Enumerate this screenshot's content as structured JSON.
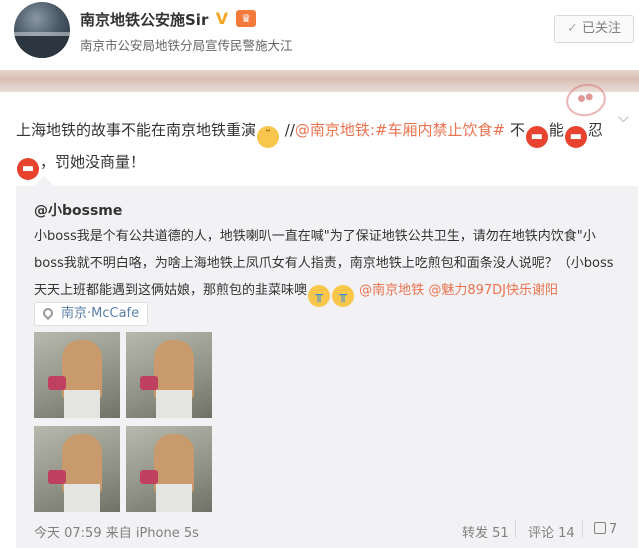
{
  "author": {
    "name": "南京地铁公安施Sir",
    "description": "南京市公安局地铁分局宣传民警施大江",
    "follow_label": "已关注",
    "verified_icon": "v-verified-icon",
    "member_icon": "crown-icon"
  },
  "post": {
    "text_1": "上海地铁的故事不能在南京地铁重演",
    "text_2": " //",
    "mention": "@南京地铁",
    "topic": ":#车厢内禁止饮食#",
    "text_3": " 不",
    "text_4": "能",
    "text_5": "忍",
    "text_6": "，罚她没商量！"
  },
  "retweet": {
    "user": "@小bossme",
    "text_main": "小boss我是个有公共道德的人，地铁喇叭一直在喊\"为了保证地铁公共卫生，请勿在地铁内饮食\"小boss我就不明白咯，为啥上海地铁上凤爪女有人指责，南京地铁上吃煎包和面条没人说呢？（小boss天天上班都能遇到这俩姑娘，那煎包的韭菜味噢",
    "mention_1": "@南京地铁",
    "mention_2": "@魅力897DJ快乐谢阳",
    "location": "南京·McCafe"
  },
  "footer": {
    "time_source": "今天 07:59 来自 iPhone 5s",
    "repost": "转发 51",
    "comment": "评论 14",
    "like": "7"
  },
  "colors": {
    "link": "#eb7350",
    "location": "#5b7fa8",
    "retweet_bg": "#f2f2f5"
  }
}
